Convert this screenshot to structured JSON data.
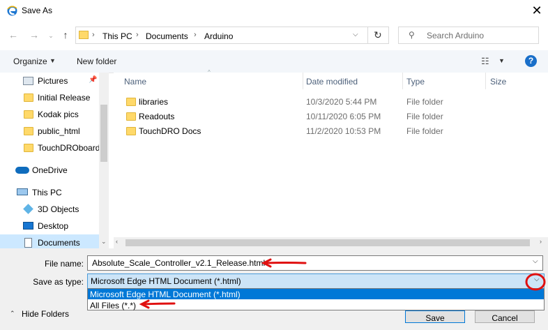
{
  "window": {
    "title": "Save As",
    "close_icon": "close-icon"
  },
  "address": {
    "crumbs": [
      "This PC",
      "Documents",
      "Arduino"
    ]
  },
  "search": {
    "placeholder": "Search Arduino"
  },
  "toolbar": {
    "organize_label": "Organize",
    "new_folder_label": "New folder",
    "help_glyph": "?"
  },
  "nav": {
    "items": [
      {
        "label": "Pictures"
      },
      {
        "label": "Initial Release"
      },
      {
        "label": "Kodak pics"
      },
      {
        "label": "public_html"
      },
      {
        "label": "TouchDROboard"
      },
      {
        "label": "OneDrive"
      },
      {
        "label": "This PC"
      },
      {
        "label": "3D Objects"
      },
      {
        "label": "Desktop"
      },
      {
        "label": "Documents"
      }
    ]
  },
  "list": {
    "columns": [
      "Name",
      "Date modified",
      "Type",
      "Size"
    ],
    "rows": [
      {
        "name": "libraries",
        "date": "10/3/2020 5:44 PM",
        "type": "File folder"
      },
      {
        "name": "Readouts",
        "date": "10/11/2020 6:05 PM",
        "type": "File folder"
      },
      {
        "name": "TouchDRO Docs",
        "date": "11/2/2020 10:53 PM",
        "type": "File folder"
      }
    ]
  },
  "form": {
    "file_name_label": "File name:",
    "file_name_value": "Absolute_Scale_Controller_v2.1_Release.html",
    "save_type_label": "Save as type:",
    "save_type_value": "Microsoft Edge HTML Document (*.html)",
    "options": [
      "Microsoft Edge HTML Document (*.html)",
      "All Files (*.*)"
    ]
  },
  "footer": {
    "hide_folders_label": "Hide Folders",
    "save_label": "Save",
    "cancel_label": "Cancel"
  },
  "colors": {
    "selection": "#0078d7",
    "annotation_red": "#e01010",
    "nav_selected": "#cce8ff"
  }
}
